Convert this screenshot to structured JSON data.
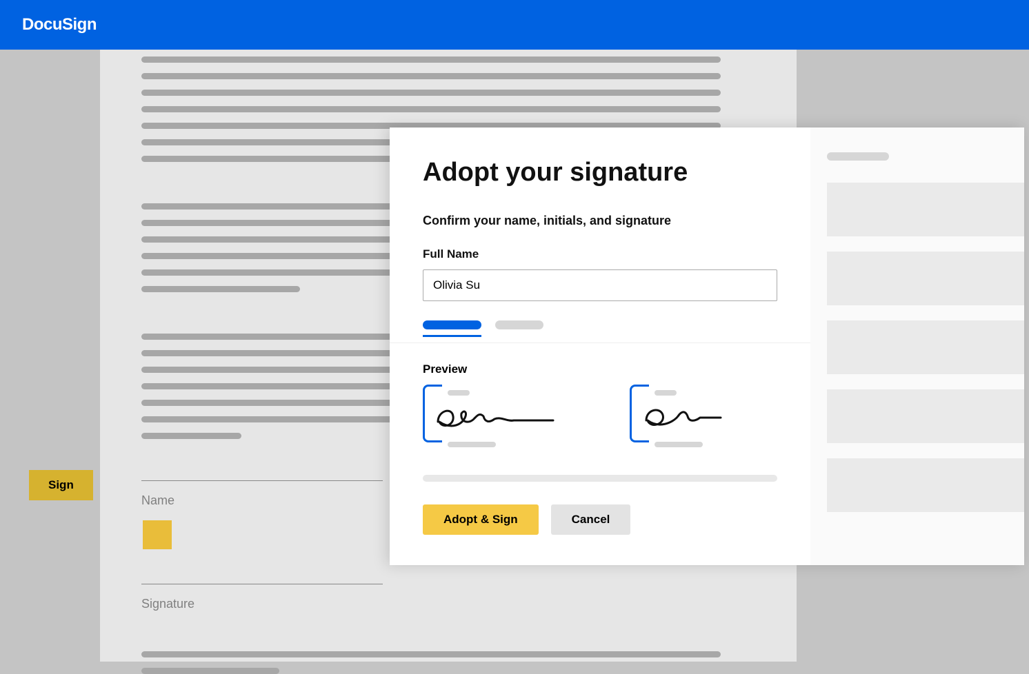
{
  "header": {
    "brand": "DocuSign"
  },
  "sign_tag": {
    "label": "Sign"
  },
  "document": {
    "field_name_label": "Name",
    "field_signature_label": "Signature"
  },
  "modal": {
    "title": "Adopt your signature",
    "subtitle": "Confirm your name, initials, and signature",
    "full_name_label": "Full Name",
    "full_name_value": "Olivia Su",
    "preview_label": "Preview",
    "adopt_button": "Adopt & Sign",
    "cancel_button": "Cancel"
  }
}
